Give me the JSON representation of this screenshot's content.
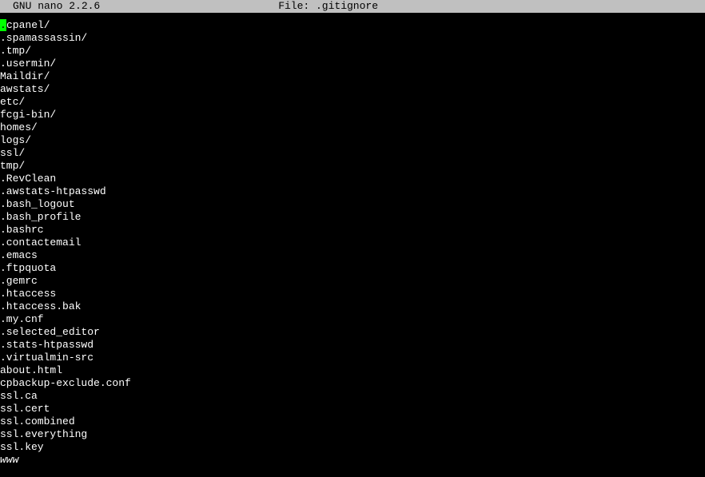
{
  "titlebar": {
    "app": "GNU nano 2.2.6",
    "file_label": "File: .gitignore"
  },
  "editor": {
    "lines": [
      ".cpanel/",
      ".spamassassin/",
      ".tmp/",
      ".usermin/",
      "Maildir/",
      "awstats/",
      "etc/",
      "fcgi-bin/",
      "homes/",
      "logs/",
      "ssl/",
      "tmp/",
      ".RevClean",
      ".awstats-htpasswd",
      ".bash_logout",
      ".bash_profile",
      ".bashrc",
      ".contactemail",
      ".emacs",
      ".ftpquota",
      ".gemrc",
      ".htaccess",
      ".htaccess.bak",
      ".my.cnf",
      ".selected_editor",
      ".stats-htpasswd",
      ".virtualmin-src",
      "about.html",
      "cpbackup-exclude.conf",
      "ssl.ca",
      "ssl.cert",
      "ssl.combined",
      "ssl.everything",
      "ssl.key",
      "www"
    ],
    "cursor_line": 0,
    "cursor_col": 0,
    "italic_lines": [
      34
    ]
  }
}
